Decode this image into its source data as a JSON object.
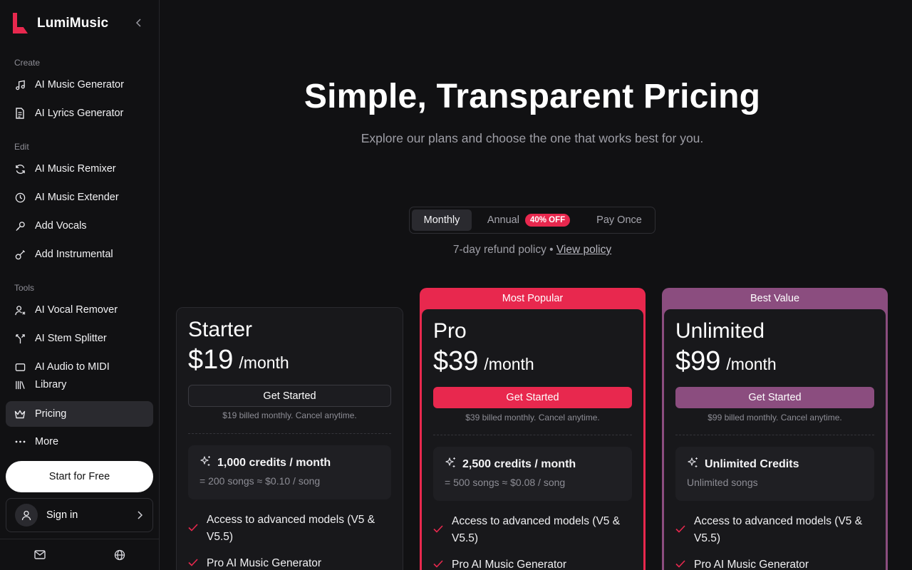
{
  "brand": {
    "name": "LumiMusic"
  },
  "sidebar": {
    "sections": [
      {
        "label": "Create"
      },
      {
        "label": "Edit"
      },
      {
        "label": "Tools"
      }
    ],
    "items": [
      {
        "label": "AI Music Generator",
        "icon": "music-note-icon"
      },
      {
        "label": "AI Lyrics Generator",
        "icon": "document-icon"
      },
      {
        "label": "AI Music Remixer",
        "icon": "refresh-icon"
      },
      {
        "label": "AI Music Extender",
        "icon": "clock-icon"
      },
      {
        "label": "Add Vocals",
        "icon": "microphone-icon"
      },
      {
        "label": "Add Instrumental",
        "icon": "guitar-icon"
      },
      {
        "label": "AI Vocal Remover",
        "icon": "user-remove-icon"
      },
      {
        "label": "AI Stem Splitter",
        "icon": "split-icon"
      },
      {
        "label": "AI Audio to MIDI",
        "icon": "midi-icon"
      },
      {
        "label": "Library",
        "icon": "library-icon"
      },
      {
        "label": "Pricing",
        "icon": "crown-icon",
        "active": true
      },
      {
        "label": "More",
        "icon": "more-icon"
      }
    ],
    "start_free": "Start for Free",
    "sign_in": "Sign in"
  },
  "hero": {
    "title": "Simple, Transparent Pricing",
    "subtitle": "Explore our plans and choose the one that works best for you."
  },
  "billing": {
    "options": [
      "Monthly",
      "Annual",
      "Pay Once"
    ],
    "selected": "Monthly",
    "annual_badge": "40% OFF",
    "refund_text": "7-day refund policy •",
    "refund_link": "View policy"
  },
  "plans": [
    {
      "name": "Starter",
      "price": "$19",
      "period": "/month",
      "cta": "Get Started",
      "billed": "$19 billed monthly. Cancel anytime.",
      "credits": "1,000 credits / month",
      "credits_sub": "= 200 songs ≈ $0.10 / song",
      "features": [
        "Access to advanced models (V5 & V5.5)",
        "Pro AI Music Generator"
      ]
    },
    {
      "name": "Pro",
      "ribbon": "Most Popular",
      "price": "$39",
      "period": "/month",
      "cta": "Get Started",
      "billed": "$39 billed monthly. Cancel anytime.",
      "credits": "2,500 credits / month",
      "credits_sub": "= 500 songs ≈ $0.08 / song",
      "features": [
        "Access to advanced models (V5 & V5.5)",
        "Pro AI Music Generator"
      ]
    },
    {
      "name": "Unlimited",
      "ribbon": "Best Value",
      "price": "$99",
      "period": "/month",
      "cta": "Get Started",
      "billed": "$99 billed monthly. Cancel anytime.",
      "credits": "Unlimited Credits",
      "credits_sub": "Unlimited songs",
      "features": [
        "Access to advanced models (V5 & V5.5)",
        "Pro AI Music Generator"
      ]
    }
  ],
  "colors": {
    "accent": "#e8284e",
    "best_value": "#8b4d7f",
    "background": "#111113",
    "card": "#18181b"
  }
}
